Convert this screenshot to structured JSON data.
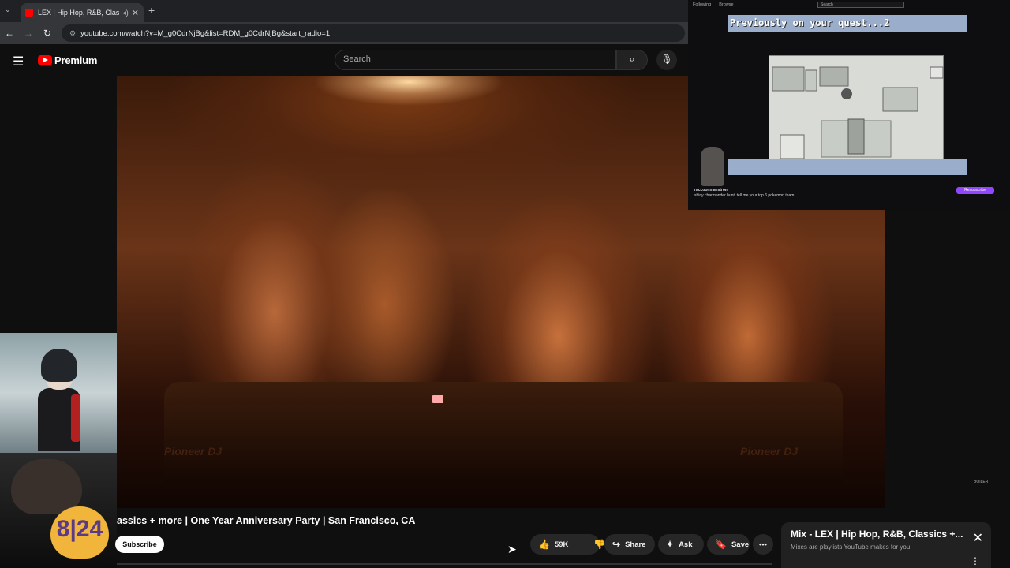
{
  "browser": {
    "tab_title": "LEX | Hip Hop, R&B, Classic",
    "url": "youtube.com/watch?v=M_g0CdrNjBg&list=RDM_g0CdrNjBg&start_radio=1"
  },
  "masthead": {
    "logo_text": "Premium",
    "search_placeholder": "Search"
  },
  "stream": {
    "top_links": [
      "Following",
      "Browse"
    ],
    "search_placeholder": "Search",
    "banner_text": "Previously on your quest...2",
    "channel_name": "raccoonmaestrom",
    "chat_line": "shiny charmander hunt, tell me your top 6 pokemon team",
    "subscribe_label": "Resubscribe"
  },
  "overlay": {
    "heart_text": "8|24"
  },
  "video": {
    "title": "assics + more | One Year Anniversary Party | San Francisco, CA",
    "brand_labels": [
      "Pioneer DJ",
      "Pioneer DJ"
    ],
    "watermark": "BOILER"
  },
  "actions": {
    "subscribe_label": "Subscribe",
    "like_count": "59K",
    "share_label": "Share",
    "ask_label": "Ask",
    "save_label": "Save"
  },
  "queue": {
    "title": "Mix - LEX | Hip Hop, R&B, Classics +...",
    "subtitle": "Mixes are playlists YouTube makes for you"
  },
  "colors": {
    "accent": "#ff0000",
    "background": "#0f0f0f",
    "button_bg": "#272727",
    "twitch_purple": "#9147ff"
  }
}
